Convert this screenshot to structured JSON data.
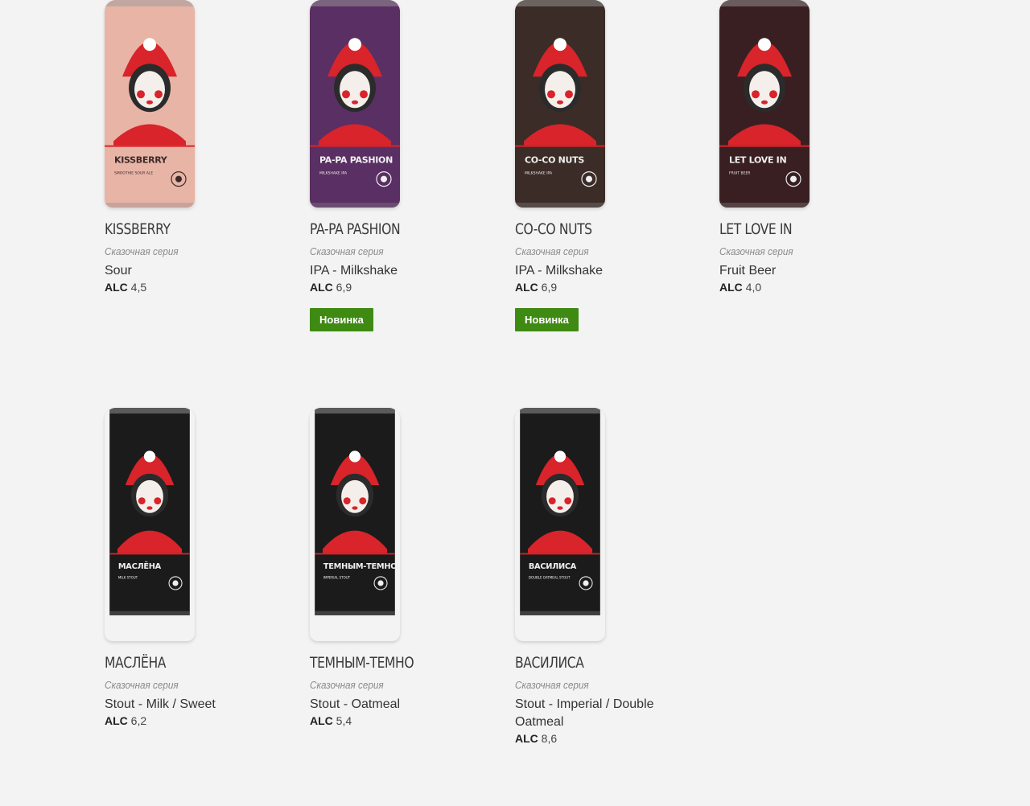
{
  "products": [
    {
      "name": "KISSBERRY",
      "series": "Сказочная серия",
      "style": "Sour",
      "alc_label": "ALC",
      "alc": "4,5",
      "badge": "",
      "can": {
        "label": "KISSBERRY",
        "sub": "SMOOTHIE SOUR ALE",
        "bg": "#e8b4a6",
        "accent": "#d8242a",
        "dark": false
      }
    },
    {
      "name": "PA-PA PASHION",
      "series": "Сказочная серия",
      "style": "IPA - Milkshake",
      "alc_label": "ALC",
      "alc": "6,9",
      "badge": "Новинка",
      "can": {
        "label": "PA-PA PASHION",
        "sub": "MILKSHAKE IPA",
        "bg": "#5a2f63",
        "accent": "#d8242a",
        "dark": true
      }
    },
    {
      "name": "CO-CO NUTS",
      "series": "Сказочная серия",
      "style": "IPA - Milkshake",
      "alc_label": "ALC",
      "alc": "6,9",
      "badge": "Новинка",
      "can": {
        "label": "CO-CO NUTS",
        "sub": "MILKSHAKE IPA",
        "bg": "#3b2c27",
        "accent": "#d8242a",
        "dark": true
      }
    },
    {
      "name": "LET LOVE IN",
      "series": "Сказочная серия",
      "style": "Fruit Beer",
      "alc_label": "ALC",
      "alc": "4,0",
      "badge": "",
      "can": {
        "label": "LET LOVE IN",
        "sub": "FRUIT BEER",
        "bg": "#3a1f22",
        "accent": "#d8242a",
        "dark": true
      }
    },
    {
      "name": "МАСЛЁНА",
      "series": "Сказочная серия",
      "style": "Stout - Milk / Sweet",
      "alc_label": "ALC",
      "alc": "6,2",
      "badge": "",
      "can": {
        "label": "МАСЛЁНА",
        "sub": "MILK STOUT",
        "bg": "#1b1b1b",
        "accent": "#d8242a",
        "dark": true
      }
    },
    {
      "name": "ТЕМНЫМ-ТЕМНО",
      "series": "Сказочная серия",
      "style": "Stout - Oatmeal",
      "alc_label": "ALC",
      "alc": "5,4",
      "badge": "",
      "can": {
        "label": "ТЕМНЫМ-ТЕМНО",
        "sub": "IMPERIAL STOUT",
        "bg": "#1b1b1b",
        "accent": "#d8242a",
        "dark": true
      }
    },
    {
      "name": "ВАСИЛИСА",
      "series": "Сказочная серия",
      "style": "Stout - Imperial / Double Oatmeal",
      "alc_label": "ALC",
      "alc": "8,6",
      "badge": "",
      "can": {
        "label": "ВАСИЛИСА",
        "sub": "DOUBLE OATMEAL STOUT",
        "bg": "#1b1b1b",
        "accent": "#d8242a",
        "dark": true
      }
    }
  ]
}
